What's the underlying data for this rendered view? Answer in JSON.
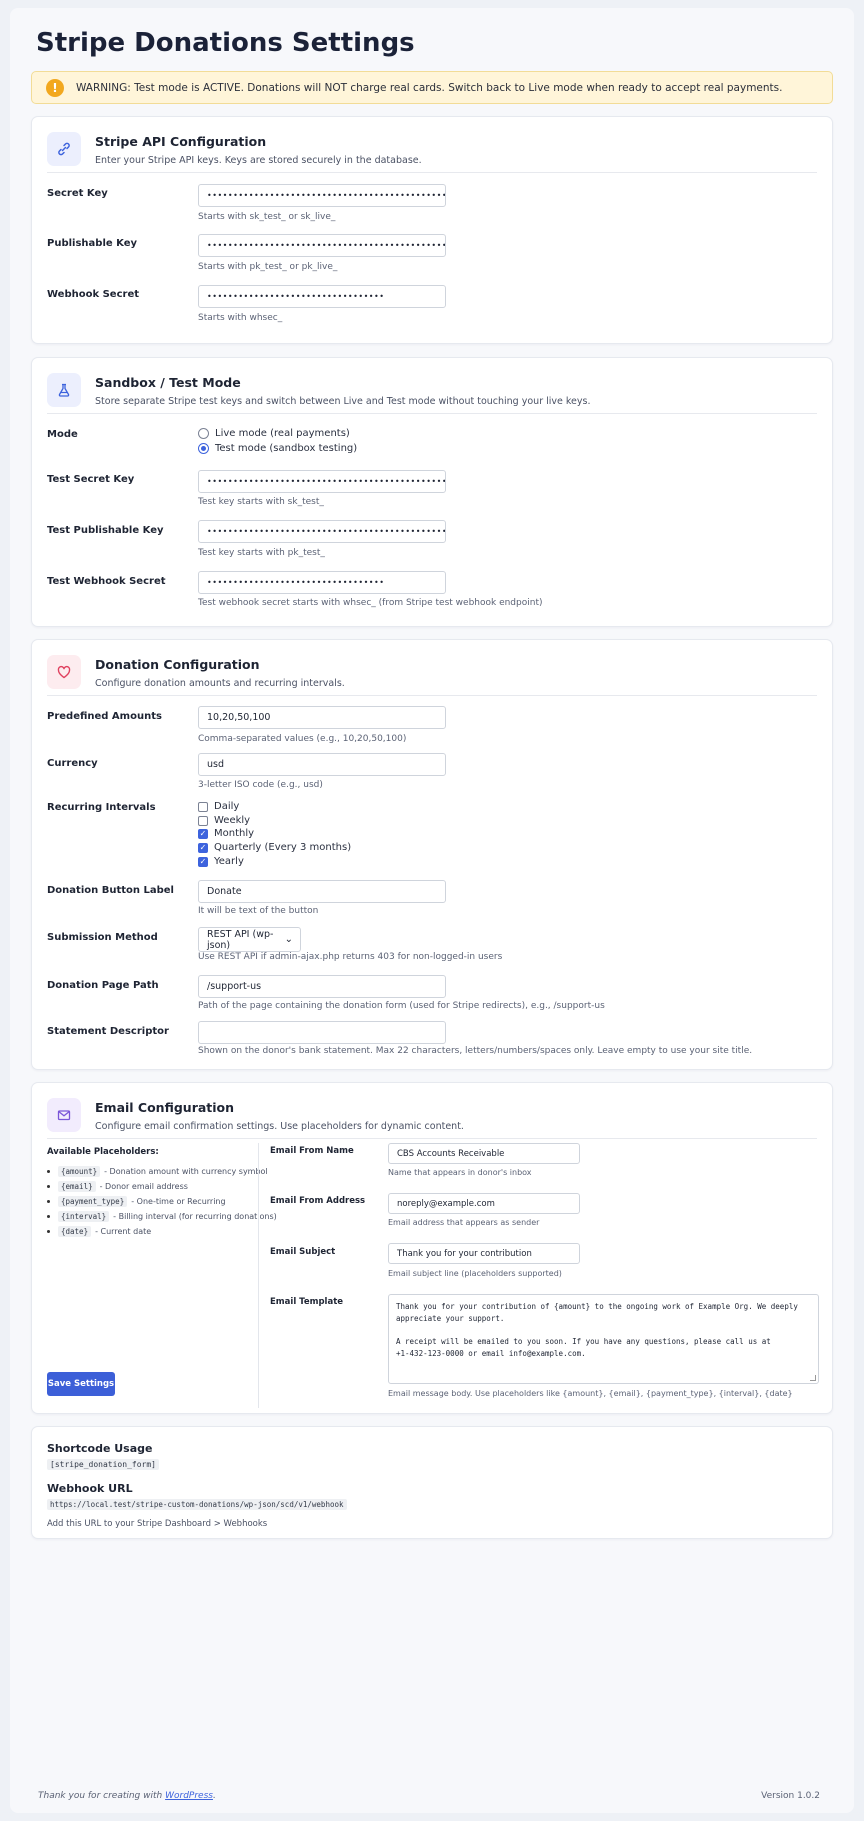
{
  "page": {
    "title": "Stripe Donations Settings"
  },
  "warning": {
    "text": "WARNING: Test mode is ACTIVE. Donations will NOT charge real cards. Switch back to Live mode when ready to accept real payments."
  },
  "api": {
    "title": "Stripe API Configuration",
    "subtitle": "Enter your Stripe API keys. Keys are stored securely in the database.",
    "secret_label": "Secret Key",
    "secret_value": "••••••••••••••••••••••••••••••••••••••••••••••••••••••••••••••",
    "secret_hint": "Starts with sk_test_ or sk_live_",
    "pub_label": "Publishable Key",
    "pub_value": "••••••••••••••••••••••••••••••••••••••••••••••••••••••••••••••",
    "pub_hint": "Starts with pk_test_ or pk_live_",
    "webhook_label": "Webhook Secret",
    "webhook_value": "••••••••••••••••••••••••••••••••••",
    "webhook_hint": "Starts with whsec_"
  },
  "sandbox": {
    "title": "Sandbox / Test Mode",
    "subtitle": "Store separate Stripe test keys and switch between Live and Test mode without touching your live keys.",
    "mode_label": "Mode",
    "live_option": "Live mode (real payments)",
    "test_option": "Test mode (sandbox testing)",
    "selected": "test",
    "test_secret_label": "Test Secret Key",
    "test_secret_value": "••••••••••••••••••••••••••••••••••••••••••••••••••••••••••••••",
    "test_secret_hint": "Test key starts with sk_test_",
    "test_pub_label": "Test Publishable Key",
    "test_pub_value": "••••••••••••••••••••••••••••••••••••••••••••••••••••••••••••••",
    "test_pub_hint": "Test key starts with pk_test_",
    "test_webhook_label": "Test Webhook Secret",
    "test_webhook_value": "••••••••••••••••••••••••••••••••••",
    "test_webhook_hint": "Test webhook secret starts with whsec_ (from Stripe test webhook endpoint)"
  },
  "donation": {
    "title": "Donation Configuration",
    "subtitle": "Configure donation amounts and recurring intervals.",
    "amounts_label": "Predefined Amounts",
    "amounts_value": "10,20,50,100",
    "amounts_hint": "Comma-separated values (e.g., 10,20,50,100)",
    "currency_label": "Currency",
    "currency_value": "usd",
    "currency_hint": "3-letter ISO code (e.g., usd)",
    "intervals_label": "Recurring Intervals",
    "intervals": [
      {
        "label": "Daily",
        "checked": false
      },
      {
        "label": "Weekly",
        "checked": false
      },
      {
        "label": "Monthly",
        "checked": true
      },
      {
        "label": "Quarterly (Every 3 months)",
        "checked": true
      },
      {
        "label": "Yearly",
        "checked": true
      }
    ],
    "button_label_label": "Donation Button Label",
    "button_label_value": "Donate",
    "button_label_hint": "It will be text of the button",
    "method_label": "Submission Method",
    "method_value": "REST API (wp-json)",
    "method_hint": "Use REST API if admin-ajax.php returns 403 for non-logged-in users",
    "path_label": "Donation Page Path",
    "path_value": "/support-us",
    "path_hint": "Path of the page containing the donation form (used for Stripe redirects), e.g., /support-us",
    "descriptor_label": "Statement Descriptor",
    "descriptor_value": "",
    "descriptor_hint": "Shown on the donor's bank statement. Max 22 characters, letters/numbers/spaces only. Leave empty to use your site title."
  },
  "email": {
    "title": "Email Configuration",
    "subtitle": "Configure email confirmation settings. Use placeholders for dynamic content.",
    "placeholders_title": "Available Placeholders:",
    "placeholders": [
      {
        "code": "{amount}",
        "desc": "- Donation amount with currency symbol"
      },
      {
        "code": "{email}",
        "desc": "- Donor email address"
      },
      {
        "code": "{payment_type}",
        "desc": "- One-time or Recurring"
      },
      {
        "code": "{interval}",
        "desc": "- Billing interval (for recurring donations)"
      },
      {
        "code": "{date}",
        "desc": "- Current date"
      }
    ],
    "from_name_label": "Email From Name",
    "from_name_value": "CBS Accounts Receivable",
    "from_name_hint": "Name that appears in donor's inbox",
    "from_addr_label": "Email From Address",
    "from_addr_value": "noreply@example.com",
    "from_addr_hint": "Email address that appears as sender",
    "subject_label": "Email Subject",
    "subject_value": "Thank you for your contribution",
    "subject_hint": "Email subject line (placeholders supported)",
    "template_label": "Email Template",
    "template_value": "Thank you for your contribution of {amount} to the ongoing work of Example Org. We deeply\nappreciate your support.\n\nA receipt will be emailed to you soon. If you have any questions, please call us at\n+1-432-123-0000 or email info@example.com.",
    "template_hint": "Email message body. Use placeholders like {amount}, {email}, {payment_type}, {interval}, {date}",
    "save_label": "Save Settings"
  },
  "shortcode": {
    "title": "Shortcode Usage",
    "code": "[stripe_donation_form]",
    "webhook_title": "Webhook URL",
    "webhook_url": "https://local.test/stripe-custom-donations/wp-json/scd/v1/webhook",
    "webhook_note": "Add this URL to your Stripe Dashboard > Webhooks"
  },
  "footer": {
    "thanks_prefix": "Thank you for creating with ",
    "thanks_link": "WordPress",
    "thanks_suffix": ".",
    "version": "Version 1.0.2"
  },
  "colors": {
    "accent": "#3d63dd",
    "warning_bg": "#fff5d9",
    "warning_icon": "#f2a81e",
    "heart": "#e0415f"
  }
}
